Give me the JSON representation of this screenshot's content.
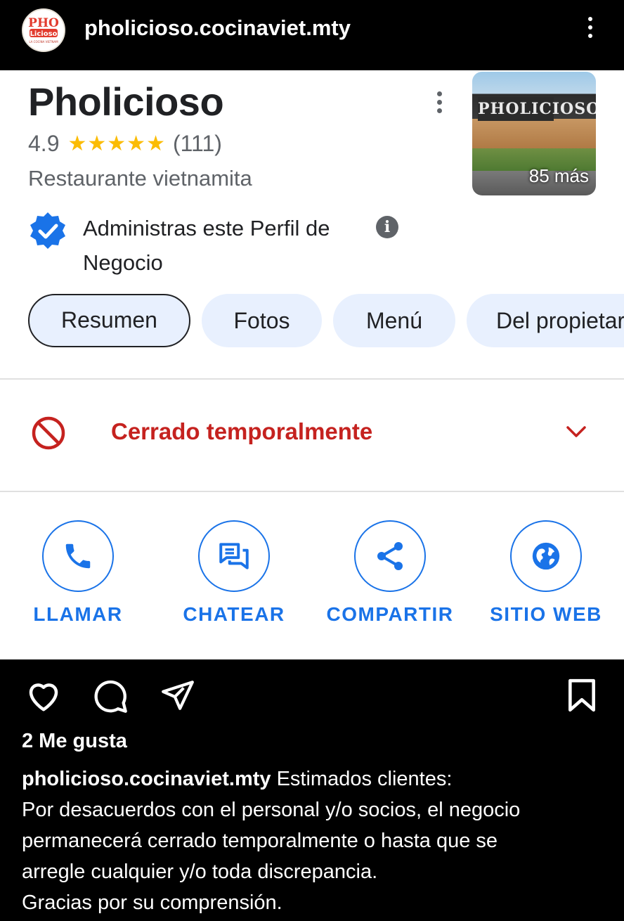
{
  "instagram": {
    "username": "pholicioso.cocinaviet.mty",
    "likes": "2 Me gusta",
    "caption_user": "pholicioso.cocinaviet.mty",
    "caption_lines": [
      "Estimados clientes:",
      "Por desacuerdos con el personal y/o socios, el negocio",
      "permanecerá cerrado temporalmente o hasta que se",
      "arregle cualquier y/o toda discrepancia.",
      "Gracias por su comprensión."
    ],
    "icons": [
      "heart-icon",
      "comment-icon",
      "share-icon",
      "bookmark-icon",
      "more-vert-icon"
    ]
  },
  "business": {
    "name": "Pholicioso",
    "rating": "4.9",
    "stars": "★★★★★",
    "review_count": "(111)",
    "category": "Restaurante vietnamita",
    "photo_more": "85 más",
    "photo_sign": "PHOLICIOSO",
    "verified_text": "Administras este Perfil de Negocio",
    "tabs": [
      "Resumen",
      "Fotos",
      "Menú",
      "Del propietario"
    ],
    "active_tab": "Resumen",
    "status": "Cerrado temporalmente",
    "actions": [
      "LLAMAR",
      "CHATEAR",
      "COMPARTIR",
      "SITIO WEB"
    ]
  },
  "colors": {
    "accent_blue": "#1a73e8",
    "closed_red": "#c5221f",
    "star_yellow": "#fbbc04",
    "chip_bg": "#e8f0fe"
  },
  "logo": {
    "line1": "PHO",
    "line2": "Licioso",
    "line3": "LA COCINA VIETNAM"
  }
}
